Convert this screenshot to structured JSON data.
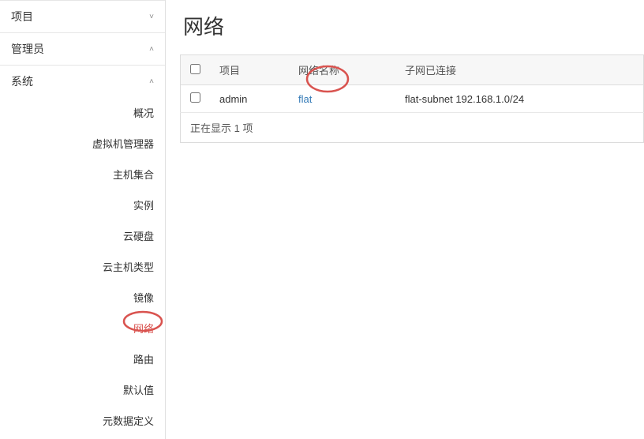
{
  "sidebar": {
    "panels": [
      {
        "title": "项目",
        "expanded": false
      },
      {
        "title": "管理员",
        "expanded": true
      },
      {
        "title": "系统",
        "expanded": true
      }
    ],
    "system_items": [
      {
        "label": "概况",
        "active": false
      },
      {
        "label": "虚拟机管理器",
        "active": false
      },
      {
        "label": "主机集合",
        "active": false
      },
      {
        "label": "实例",
        "active": false
      },
      {
        "label": "云硬盘",
        "active": false
      },
      {
        "label": "云主机类型",
        "active": false
      },
      {
        "label": "镜像",
        "active": false
      },
      {
        "label": "网络",
        "active": true
      },
      {
        "label": "路由",
        "active": false
      },
      {
        "label": "默认值",
        "active": false
      },
      {
        "label": "元数据定义",
        "active": false
      }
    ]
  },
  "page": {
    "title": "网络"
  },
  "table": {
    "headers": {
      "project": "项目",
      "network_name": "网络名称",
      "subnets": "子网已连接"
    },
    "rows": [
      {
        "project": "admin",
        "network_name": "flat",
        "subnets": "flat-subnet 192.168.1.0/24"
      }
    ],
    "footer": "正在显示 1 项"
  },
  "chevrons": {
    "down": "˅",
    "up": "˄"
  }
}
